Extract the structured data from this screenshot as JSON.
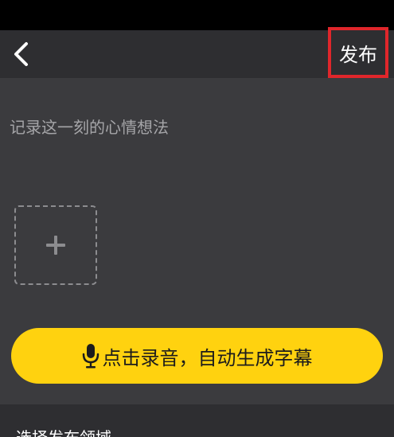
{
  "colors": {
    "status_bar": "#000000",
    "nav_bar": "#2e2e31",
    "background": "#3b3b3e",
    "accent_yellow": "#ffd20f",
    "highlight_red": "#e0262b",
    "placeholder_text": "#a5a5a8"
  },
  "nav": {
    "back_icon": "chevron-left-icon",
    "publish_label": "发布"
  },
  "post": {
    "placeholder": "记录这一刻的心情想法",
    "add_media_icon": "plus-icon"
  },
  "record": {
    "icon": "microphone-icon",
    "label": "点击录音，自动生成字幕"
  },
  "section": {
    "title": "选择发布领域"
  }
}
